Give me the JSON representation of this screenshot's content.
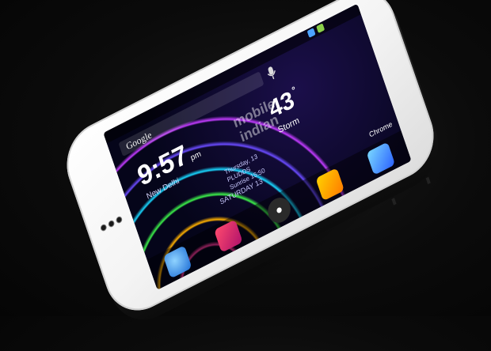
{
  "screen": {
    "status_time": "",
    "search_label": "Google",
    "clock_time": "9:57",
    "clock_ampm": "pm",
    "city": "New Delhi",
    "temperature": "43",
    "temperature_unit": "°",
    "condition": "Storm",
    "weather_detail_1": "Thursday, 13",
    "weather_detail_2": "PLUDDS",
    "weather_detail_3": "Sunrise 15:50",
    "date_line": "SATURDAY 13",
    "watermark_line_1": "mobile",
    "watermark_line_2": "indian",
    "app_label": "Chrome"
  },
  "colors": {
    "phone_body": "#f2f2f2",
    "screen_bg": "#04040f",
    "accent_blue": "#4da3ff"
  },
  "icons": [
    "search-icon",
    "mic-icon",
    "phone-app-icon",
    "contacts-app-icon",
    "app-drawer-icon",
    "messages-app-icon",
    "browser-app-icon",
    "front-camera-icon",
    "earpiece-icon"
  ]
}
